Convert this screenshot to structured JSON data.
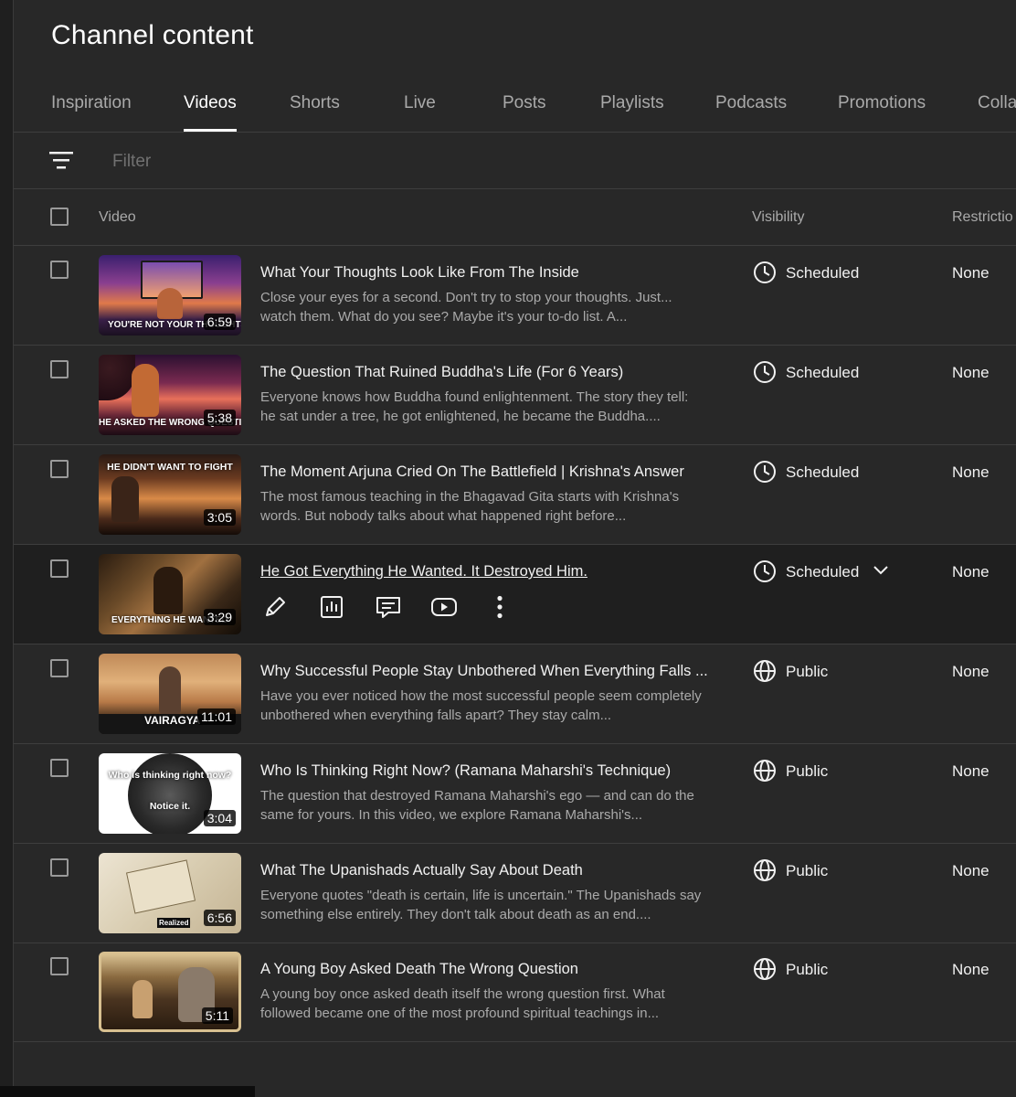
{
  "page": {
    "title": "Channel content"
  },
  "tabs": [
    {
      "label": "Inspiration"
    },
    {
      "label": "Videos",
      "active": true
    },
    {
      "label": "Shorts"
    },
    {
      "label": "Live"
    },
    {
      "label": "Posts"
    },
    {
      "label": "Playlists"
    },
    {
      "label": "Podcasts"
    },
    {
      "label": "Promotions"
    },
    {
      "label": "Colla"
    }
  ],
  "filter": {
    "placeholder": "Filter"
  },
  "table": {
    "columns": {
      "video": "Video",
      "visibility": "Visibility",
      "restrictions": "Restrictio"
    },
    "rows": [
      {
        "title": "What Your Thoughts Look Like From The Inside",
        "description": "Close your eyes for a second. Don't try to stop your thoughts. Just... watch them. What do you see? Maybe it's your to-do list. A...",
        "duration": "6:59",
        "thumb_caption": "YOU'RE NOT YOUR THOUGHTS",
        "visibility": "Scheduled",
        "visibility_icon": "clock-icon",
        "restrictions": "None"
      },
      {
        "title": "The Question That Ruined Buddha's Life (For 6 Years)",
        "description": "Everyone knows how Buddha found enlightenment. The story they tell: he sat under a tree, he got enlightened, he became the Buddha....",
        "duration": "5:38",
        "thumb_caption": "HE ASKED THE WRONG QUESTION",
        "visibility": "Scheduled",
        "visibility_icon": "clock-icon",
        "restrictions": "None"
      },
      {
        "title": "The Moment Arjuna Cried On The Battlefield | Krishna's Answer",
        "description": "The most famous teaching in the Bhagavad Gita starts with Krishna's words. But nobody talks about what happened right before...",
        "duration": "3:05",
        "thumb_caption": "HE DIDN'T WANT TO FIGHT",
        "visibility": "Scheduled",
        "visibility_icon": "clock-icon",
        "restrictions": "None"
      },
      {
        "title": "He Got Everything He Wanted. It Destroyed Him.",
        "description": "",
        "duration": "3:29",
        "thumb_caption": "EVERYTHING HE WANTED",
        "visibility": "Scheduled",
        "visibility_icon": "clock-icon",
        "restrictions": "None",
        "hovered": true
      },
      {
        "title": "Why Successful People Stay Unbothered When Everything Falls ...",
        "description": "Have you ever noticed how the most successful people seem completely unbothered when everything falls apart? They stay calm...",
        "duration": "11:01",
        "thumb_caption": "VAIRAGYA",
        "visibility": "Public",
        "visibility_icon": "globe-icon",
        "restrictions": "None"
      },
      {
        "title": "Who Is Thinking Right Now? (Ramana Maharshi's Technique)",
        "description": "The question that destroyed Ramana Maharshi's ego — and can do the same for yours. In this video, we explore Ramana Maharshi's...",
        "duration": "3:04",
        "thumb_caption": "Who is thinking right now?",
        "thumb_caption2": "Notice it.",
        "visibility": "Public",
        "visibility_icon": "globe-icon",
        "restrictions": "None"
      },
      {
        "title": "What The Upanishads Actually Say About Death",
        "description": "Everyone quotes \"death is certain, life is uncertain.\" The Upanishads say something else entirely. They don't talk about death as an end....",
        "duration": "6:56",
        "thumb_caption": "Realized",
        "visibility": "Public",
        "visibility_icon": "globe-icon",
        "restrictions": "None"
      },
      {
        "title": "A Young Boy Asked Death The Wrong Question",
        "description": "A young boy once asked death itself the wrong question first. What followed became one of the most profound spiritual teachings in...",
        "duration": "5:11",
        "thumb_caption": "",
        "visibility": "Public",
        "visibility_icon": "globe-icon",
        "restrictions": "None"
      }
    ]
  },
  "hover_actions": [
    "edit-details",
    "analytics",
    "comments",
    "view-on-youtube",
    "options"
  ],
  "colors": {
    "background": "#282828",
    "text": "#f1f1f1",
    "muted": "#aaaaaa",
    "divider": "#3e3e3e",
    "hover_row": "#1f1f1f"
  }
}
